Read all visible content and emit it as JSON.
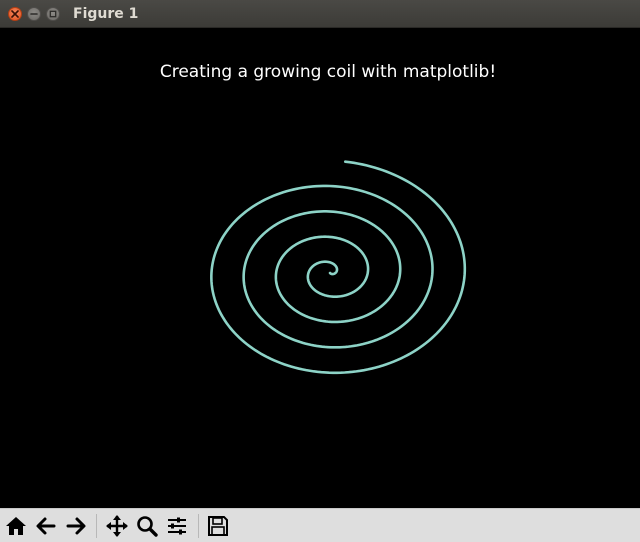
{
  "window": {
    "title": "Figure 1",
    "controls": [
      "close",
      "minimize",
      "maximize"
    ]
  },
  "figure": {
    "title": "Creating a growing coil with matplotlib!",
    "background_color": "#000000",
    "title_color": "#ffffff"
  },
  "chart_data": {
    "type": "line",
    "description_kind": "parametric spiral",
    "title": "Creating a growing coil with matplotlib!",
    "xlabel": "",
    "ylabel": "",
    "axes_visible": false,
    "grid": false,
    "line_color": "#8dd3c7",
    "series": [
      {
        "turns": 4.4,
        "radius_start": 0,
        "radius_end": 1.0,
        "aspect_x_to_y": 1.27,
        "direction": "counterclockwise outward"
      }
    ]
  },
  "toolbar": {
    "buttons": [
      {
        "icon": "home-icon",
        "tooltip": ""
      },
      {
        "icon": "back-arrow-icon",
        "tooltip": ""
      },
      {
        "icon": "forward-arrow-icon",
        "tooltip": ""
      },
      {
        "icon": "pan-icon",
        "tooltip": ""
      },
      {
        "icon": "zoom-icon",
        "tooltip": ""
      },
      {
        "icon": "configure-subplots-icon",
        "tooltip": ""
      },
      {
        "icon": "save-icon",
        "tooltip": ""
      }
    ]
  }
}
